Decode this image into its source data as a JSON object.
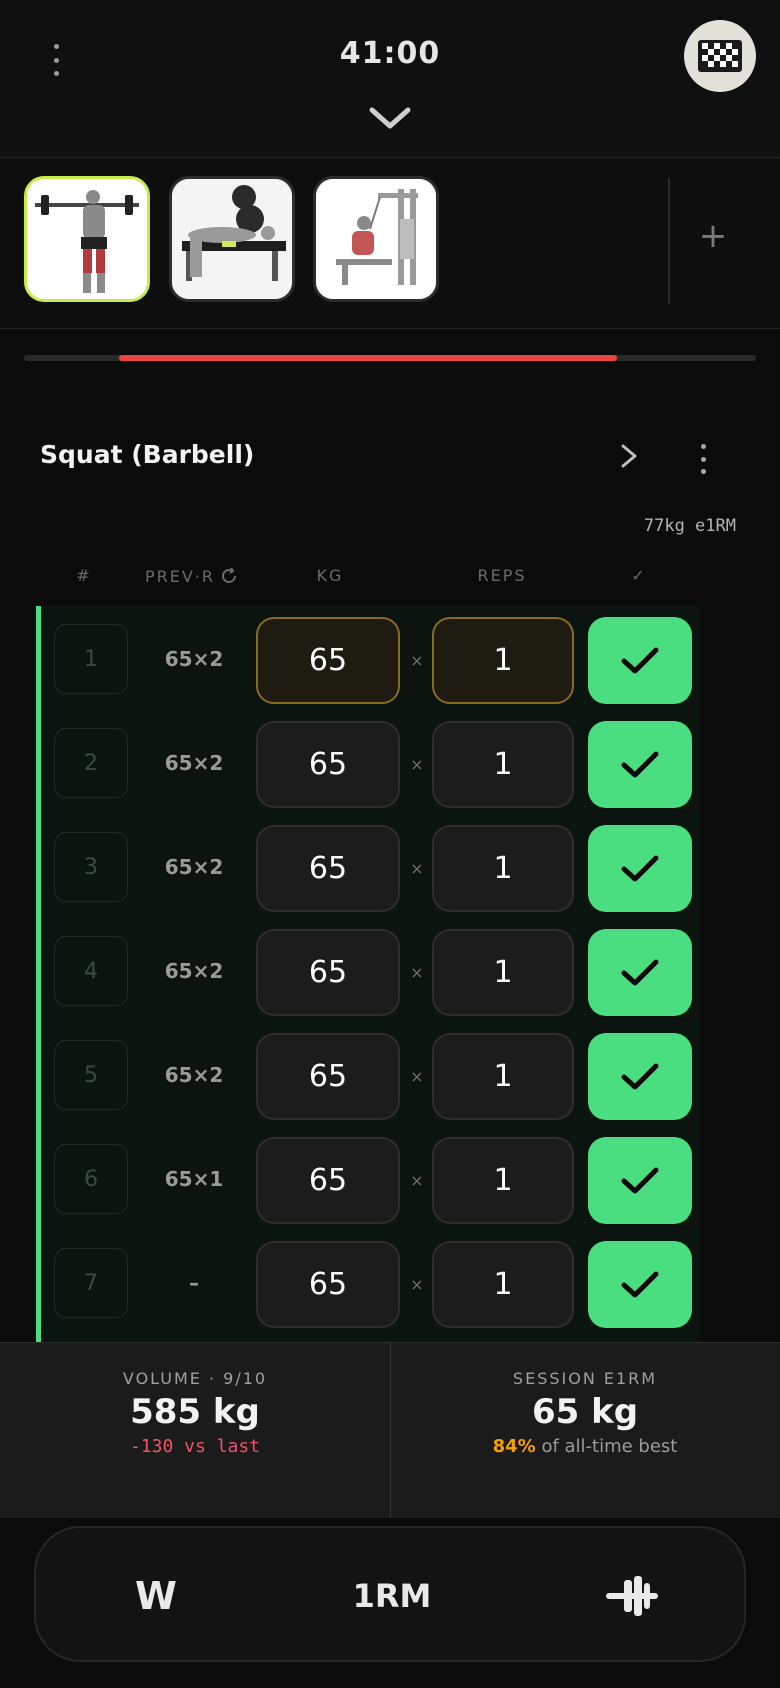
{
  "header": {
    "timer": "41:00"
  },
  "strip": {
    "exercises": [
      {
        "name": "squat-thumbnail",
        "active": true
      },
      {
        "name": "bench-press-thumbnail",
        "active": false
      },
      {
        "name": "seated-row-thumbnail",
        "active": false
      }
    ],
    "add_label": "+"
  },
  "progress": {
    "start": 0.13,
    "end": 0.81,
    "color": "#ef4444"
  },
  "exercise": {
    "title": "Squat (Barbell)",
    "e1rm_tag": "77kg e1RM"
  },
  "columns": {
    "num": "#",
    "prev": "PREV·R",
    "kg": "KG",
    "reps": "REPS",
    "done": "✓"
  },
  "sets": [
    {
      "num": "1",
      "prev": "65×2",
      "kg": "65",
      "reps": "1"
    },
    {
      "num": "2",
      "prev": "65×2",
      "kg": "65",
      "reps": "1"
    },
    {
      "num": "3",
      "prev": "65×2",
      "kg": "65",
      "reps": "1"
    },
    {
      "num": "4",
      "prev": "65×2",
      "kg": "65",
      "reps": "1"
    },
    {
      "num": "5",
      "prev": "65×2",
      "kg": "65",
      "reps": "1"
    },
    {
      "num": "6",
      "prev": "65×1",
      "kg": "65",
      "reps": "1"
    },
    {
      "num": "7",
      "prev": "–",
      "kg": "65",
      "reps": "1"
    }
  ],
  "times_symbol": "×",
  "stats": {
    "volume": {
      "label": "VOLUME · 9/10",
      "value": "585 kg",
      "delta": "-130 vs last"
    },
    "session": {
      "label": "SESSION E1RM",
      "value": "65 kg",
      "pct": "84%",
      "pct_suffix": " of all-time best"
    }
  },
  "bottom": {
    "w_label": "W",
    "rm_label": "1RM"
  },
  "colors": {
    "accent_green": "#4ade80",
    "active_border": "#c6ec4c",
    "negative": "#f05167",
    "amber": "#f59e0b"
  }
}
